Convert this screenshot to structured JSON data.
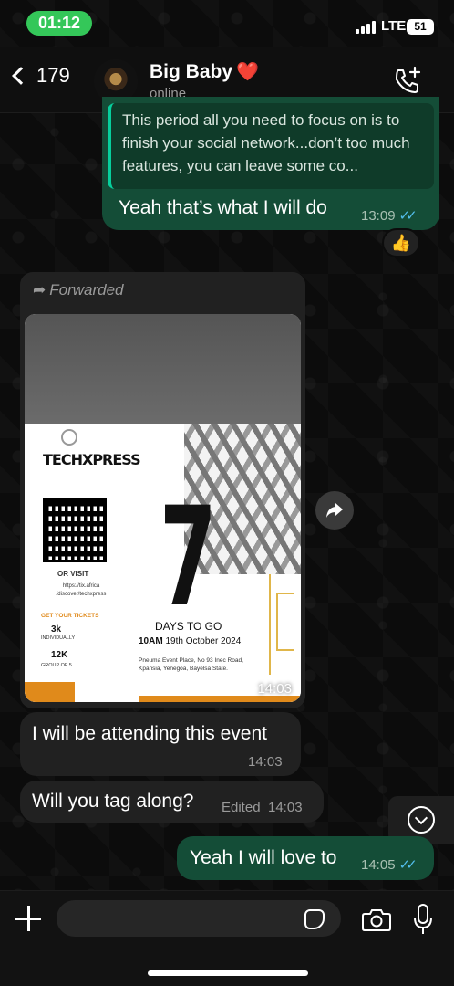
{
  "status_bar": {
    "time": "01:12",
    "network": "LTE",
    "battery": "51"
  },
  "header": {
    "back_count": "179",
    "contact_name": "Big Baby",
    "contact_status": "online",
    "heart_emoji": "❤️",
    "call_icon": "phone-plus-icon"
  },
  "messages": {
    "quoted_text": "This period all you need to focus on is to finish your social network...don’t too much features, you can leave some co...",
    "reply_text": "Yeah that’s what I will do",
    "reply_time": "13:09",
    "reaction": "👍",
    "forwarded_label": "Forwarded",
    "image_time": "14:03",
    "msg1_text": "I will be attending this event",
    "msg1_time": "14:03",
    "msg2_text": "Will you tag along?",
    "msg2_edited": "Edited",
    "msg2_time": "14:03",
    "msg3_text": "Yeah I will love to",
    "msg3_time": "14:05"
  },
  "flyer": {
    "brand": "TECHXPRESS",
    "or_visit": "OR VISIT",
    "url": "https://tix.africa /discover/techxpress",
    "get_tickets": "GET YOUR TICKETS",
    "price1": "3k",
    "price1_sub": "INDIVIDUALLY",
    "price2": "12K",
    "price2_sub": "GROUP OF 5",
    "countdown": "7",
    "days_to_go": "DAYS TO GO",
    "time": "10AM",
    "date": "19th October 2024",
    "venue": "Pneuma Event Place, No 93 Inec Road, Kpansia, Yenegoa, Bayelsa State."
  },
  "colors": {
    "outgoing_bubble": "#144d37",
    "incoming_bubble": "#212121",
    "accent_green": "#34c759",
    "read_ticks": "#53bdeb"
  }
}
